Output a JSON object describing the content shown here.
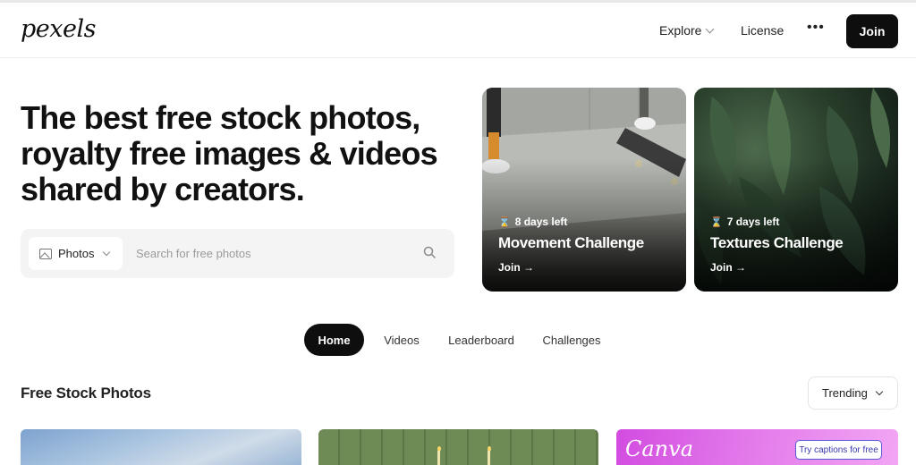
{
  "header": {
    "logo": "pexels",
    "nav": {
      "explore": "Explore",
      "license": "License",
      "more": "•••"
    },
    "join_label": "Join"
  },
  "hero": {
    "title_lines": [
      "The best free stock photos,",
      "royalty free images & videos",
      "shared by creators."
    ]
  },
  "search": {
    "type_label": "Photos",
    "placeholder": "Search for free photos",
    "icon": "search-icon"
  },
  "challenges": [
    {
      "days_left": "8 days left",
      "title": "Movement Challenge",
      "cta": "Join →"
    },
    {
      "days_left": "7 days left",
      "title": "Textures Challenge",
      "cta": "Join →"
    }
  ],
  "tabs": [
    {
      "label": "Home",
      "active": true
    },
    {
      "label": "Videos",
      "active": false
    },
    {
      "label": "Leaderboard",
      "active": false
    },
    {
      "label": "Challenges",
      "active": false
    }
  ],
  "section": {
    "title": "Free Stock Photos",
    "sort_label": "Trending"
  },
  "photos": {
    "ad_logo": "Canva",
    "ad_button": "Try captions for free"
  },
  "colors": {
    "primary_dark": "#0e0e0e",
    "search_bg": "#f4f4f4",
    "canva_accent": "#d24ce0"
  }
}
